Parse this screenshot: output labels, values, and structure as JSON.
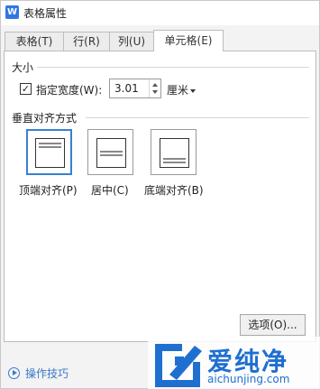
{
  "window": {
    "title": "表格属性",
    "app_icon": "W",
    "accent": "#2f78e3"
  },
  "tabs": [
    {
      "label": "表格(T)"
    },
    {
      "label": "行(R)"
    },
    {
      "label": "列(U)"
    },
    {
      "label": "单元格(E)",
      "active": true
    }
  ],
  "size_section": {
    "title": "大小",
    "width_checkbox": {
      "checked": true,
      "label": "指定宽度(W):"
    },
    "width_value": "3.01",
    "unit": "厘米"
  },
  "valign_section": {
    "title": "垂直对齐方式",
    "options": [
      {
        "label": "顶端对齐(P)",
        "selected": true
      },
      {
        "label": "居中(C)"
      },
      {
        "label": "底端对齐(B)"
      }
    ]
  },
  "buttons": {
    "options": "选项(O)..."
  },
  "footer": {
    "tips_link": "操作技巧"
  },
  "watermark": {
    "brand": "爱纯净",
    "url": "aichunjing.com"
  }
}
